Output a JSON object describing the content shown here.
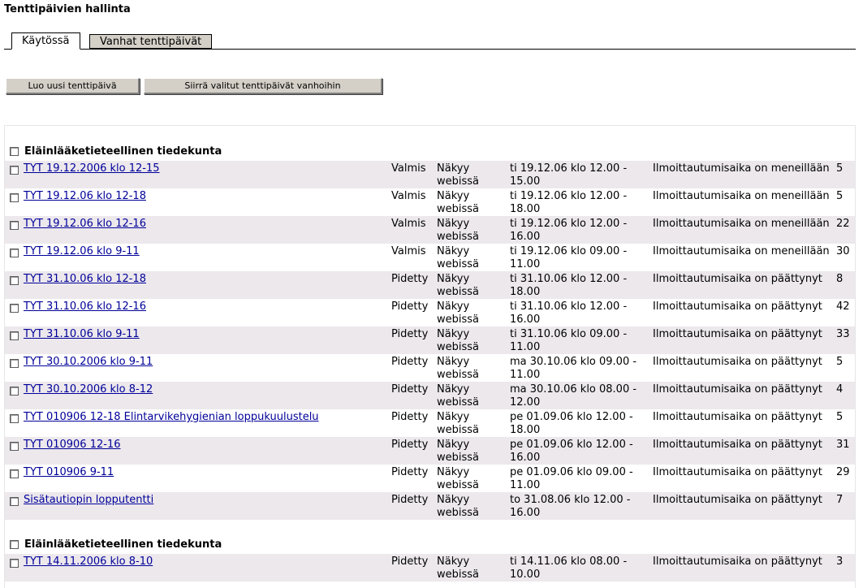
{
  "page": {
    "title": "Tenttipäivien hallinta"
  },
  "tabs": [
    {
      "label": "Käytössä",
      "active": true
    },
    {
      "label": "Vanhat tenttipäivät",
      "active": false
    }
  ],
  "buttons": {
    "create": "Luo uusi tenttipäivä",
    "move": "Siirrä valitut tenttipäivät vanhoihin"
  },
  "groups": [
    {
      "label": "Eläinlääketieteellinen tiedekunta",
      "rows": [
        {
          "name": "TYT 19.12.2006 klo 12-15",
          "status": "Valmis",
          "visibility": "Näkyy webissä",
          "time": "ti 19.12.06 klo 12.00 - 15.00",
          "registration": "Ilmoittautumisaika on meneillään",
          "count": "5"
        },
        {
          "name": "TYT 19.12.06 klo 12-18",
          "status": "Valmis",
          "visibility": "Näkyy webissä",
          "time": "ti 19.12.06 klo 12.00 - 18.00",
          "registration": "Ilmoittautumisaika on meneillään",
          "count": "5"
        },
        {
          "name": "TYT 19.12.06 klo 12-16",
          "status": "Valmis",
          "visibility": "Näkyy webissä",
          "time": "ti 19.12.06 klo 12.00 - 16.00",
          "registration": "Ilmoittautumisaika on meneillään",
          "count": "22"
        },
        {
          "name": "TYT 19.12.06 klo 9-11",
          "status": "Valmis",
          "visibility": "Näkyy webissä",
          "time": "ti 19.12.06 klo 09.00 - 11.00",
          "registration": "Ilmoittautumisaika on meneillään",
          "count": "30"
        },
        {
          "name": "TYT 31.10.06 klo 12-18",
          "status": "Pidetty",
          "visibility": "Näkyy webissä",
          "time": "ti 31.10.06 klo 12.00 - 18.00",
          "registration": "Ilmoittautumisaika on päättynyt",
          "count": "8"
        },
        {
          "name": "TYT 31.10.06 klo 12-16",
          "status": "Pidetty",
          "visibility": "Näkyy webissä",
          "time": "ti 31.10.06 klo 12.00 - 16.00",
          "registration": "Ilmoittautumisaika on päättynyt",
          "count": "42"
        },
        {
          "name": "TYT 31.10.06 klo 9-11",
          "status": "Pidetty",
          "visibility": "Näkyy webissä",
          "time": "ti 31.10.06 klo 09.00 - 11.00",
          "registration": "Ilmoittautumisaika on päättynyt",
          "count": "33"
        },
        {
          "name": "TYT 30.10.2006 klo 9-11",
          "status": "Pidetty",
          "visibility": "Näkyy webissä",
          "time": "ma 30.10.06 klo 09.00 - 11.00",
          "registration": "Ilmoittautumisaika on päättynyt",
          "count": "5"
        },
        {
          "name": "TYT 30.10.2006 klo 8-12",
          "status": "Pidetty",
          "visibility": "Näkyy webissä",
          "time": "ma 30.10.06 klo 08.00 - 12.00",
          "registration": "Ilmoittautumisaika on päättynyt",
          "count": "4"
        },
        {
          "name": "TYT 010906 12-18 Elintarvikehygienian loppukuulustelu",
          "status": "Pidetty",
          "visibility": "Näkyy webissä",
          "time": "pe 01.09.06 klo 12.00 - 18.00",
          "registration": "Ilmoittautumisaika on päättynyt",
          "count": "5"
        },
        {
          "name": "TYT 010906 12-16",
          "status": "Pidetty",
          "visibility": "Näkyy webissä",
          "time": "pe 01.09.06 klo 12.00 - 16.00",
          "registration": "Ilmoittautumisaika on päättynyt",
          "count": "31"
        },
        {
          "name": "TYT 010906 9-11",
          "status": "Pidetty",
          "visibility": "Näkyy webissä",
          "time": "pe 01.09.06 klo 09.00 - 11.00",
          "registration": "Ilmoittautumisaika on päättynyt",
          "count": "29"
        },
        {
          "name": "Sisätautiopin lopputentti",
          "status": "Pidetty",
          "visibility": "Näkyy webissä",
          "time": "to 31.08.06 klo 12.00 - 16.00",
          "registration": "Ilmoittautumisaika on päättynyt",
          "count": "7"
        }
      ]
    },
    {
      "label": "Eläinlääketieteellinen tiedekunta",
      "rows": [
        {
          "name": "TYT 14.11.2006 klo 8-10",
          "status": "Pidetty",
          "visibility": "Näkyy webissä",
          "time": "ti 14.11.06 klo 08.00 - 10.00",
          "registration": "Ilmoittautumisaika on päättynyt",
          "count": "3"
        }
      ]
    }
  ]
}
